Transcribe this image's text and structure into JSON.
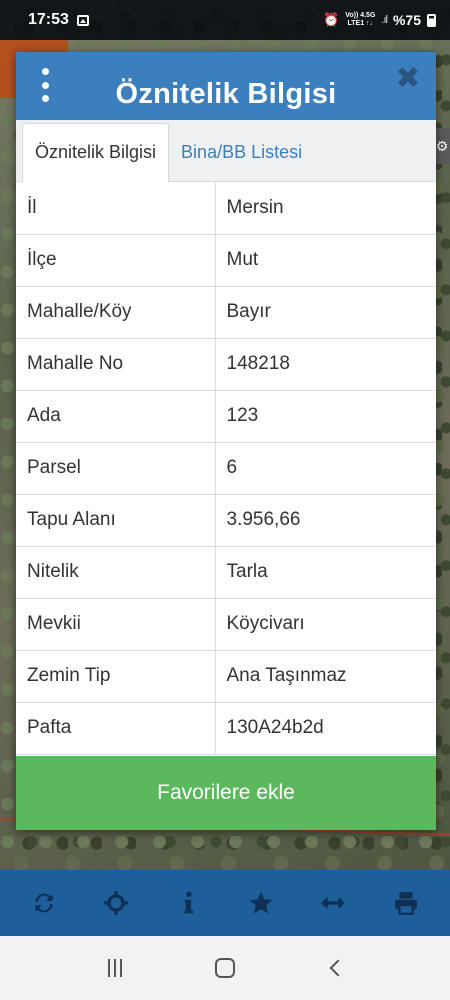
{
  "status_bar": {
    "time": "17:53",
    "network_top": "Vo)) 4.5G",
    "network_bottom": "LTE1 ↑↓",
    "battery": "%75"
  },
  "dialog": {
    "title": "Öznitelik Bilgisi",
    "tabs": [
      {
        "label": "Öznitelik Bilgisi",
        "active": true
      },
      {
        "label": "Bina/BB Listesi",
        "active": false
      }
    ],
    "rows": [
      {
        "key": "İl",
        "value": "Mersin"
      },
      {
        "key": "İlçe",
        "value": "Mut"
      },
      {
        "key": "Mahalle/Köy",
        "value": "Bayır"
      },
      {
        "key": "Mahalle No",
        "value": "148218"
      },
      {
        "key": "Ada",
        "value": "123"
      },
      {
        "key": "Parsel",
        "value": "6"
      },
      {
        "key": "Tapu Alanı",
        "value": "3.956,66"
      },
      {
        "key": "Nitelik",
        "value": "Tarla"
      },
      {
        "key": "Mevkii",
        "value": "Köycivarı"
      },
      {
        "key": "Zemin Tip",
        "value": "Ana Taşınmaz"
      },
      {
        "key": "Pafta",
        "value": "130A24b2d"
      }
    ],
    "favorite_button": "Favorilere ekle"
  },
  "toolbar": {
    "icons": [
      "refresh-icon",
      "locate-icon",
      "info-icon",
      "star-icon",
      "measure-icon",
      "print-icon"
    ]
  },
  "colors": {
    "header": "#3b7fbf",
    "favorite_button": "#5cb85c",
    "toolbar": "#1e5f99",
    "toolbar_icons": "#0f2f55"
  }
}
